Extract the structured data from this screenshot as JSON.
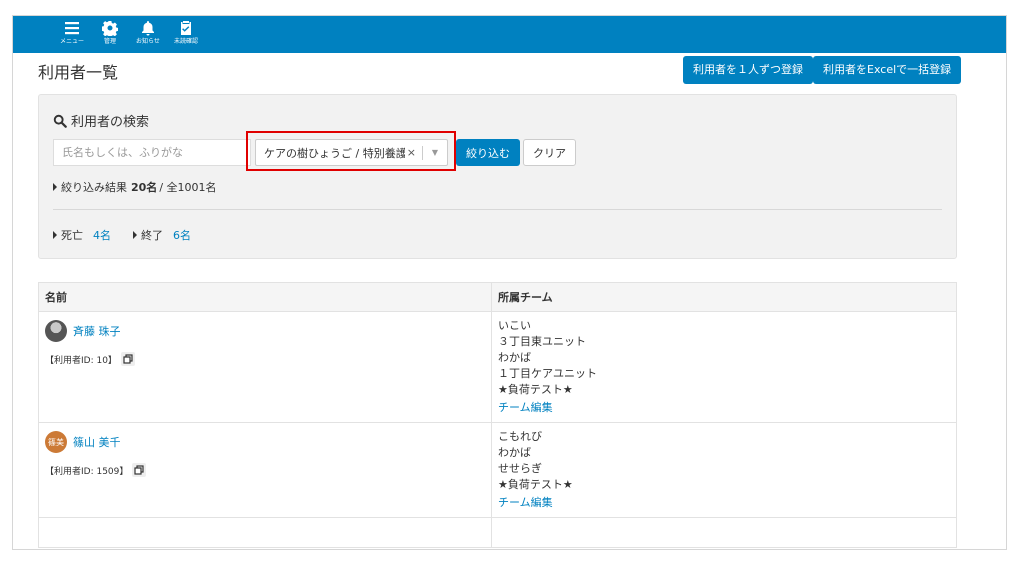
{
  "topnav": {
    "items": [
      {
        "label": "メニュー",
        "icon": "menu-icon"
      },
      {
        "label": "管理",
        "icon": "gear-icon"
      },
      {
        "label": "お知らせ",
        "icon": "bell-icon"
      },
      {
        "label": "未読確認",
        "icon": "clipboard-check-icon"
      }
    ]
  },
  "page": {
    "title": "利用者一覧",
    "register_one_label": "利用者を１人ずつ登録",
    "register_excel_label": "利用者をExcelで一括登録"
  },
  "search": {
    "title": "利用者の検索",
    "name_placeholder": "氏名もしくは、ふりがな",
    "facility_value": "ケアの樹ひょうご / 特別養護...",
    "filter_label": "絞り込む",
    "clear_label": "クリア",
    "result_prefix": "絞り込み結果",
    "result_count": "20名",
    "result_total": "/ 全1001名",
    "status": [
      {
        "label": "死亡",
        "count": "4名"
      },
      {
        "label": "終了",
        "count": "6名"
      }
    ]
  },
  "table": {
    "headers": [
      "名前",
      "所属チーム"
    ],
    "rows": [
      {
        "name": "斉藤 珠子",
        "avatar_initials": "",
        "user_id": "【利用者ID: 10】",
        "teams": [
          "いこい",
          "３丁目東ユニット",
          "わかば",
          "１丁目ケアユニット",
          "★負荷テスト★"
        ],
        "team_edit": "チーム編集"
      },
      {
        "name": "篠山 美千",
        "avatar_initials": "篠美",
        "user_id": "【利用者ID: 1509】",
        "teams": [
          "こもれび",
          "わかば",
          "せせらぎ",
          "★負荷テスト★"
        ],
        "team_edit": "チーム編集"
      }
    ]
  },
  "colors": {
    "brand": "#0081c0",
    "highlight": "#e00000",
    "avatar_orange": "#cc7a36"
  }
}
